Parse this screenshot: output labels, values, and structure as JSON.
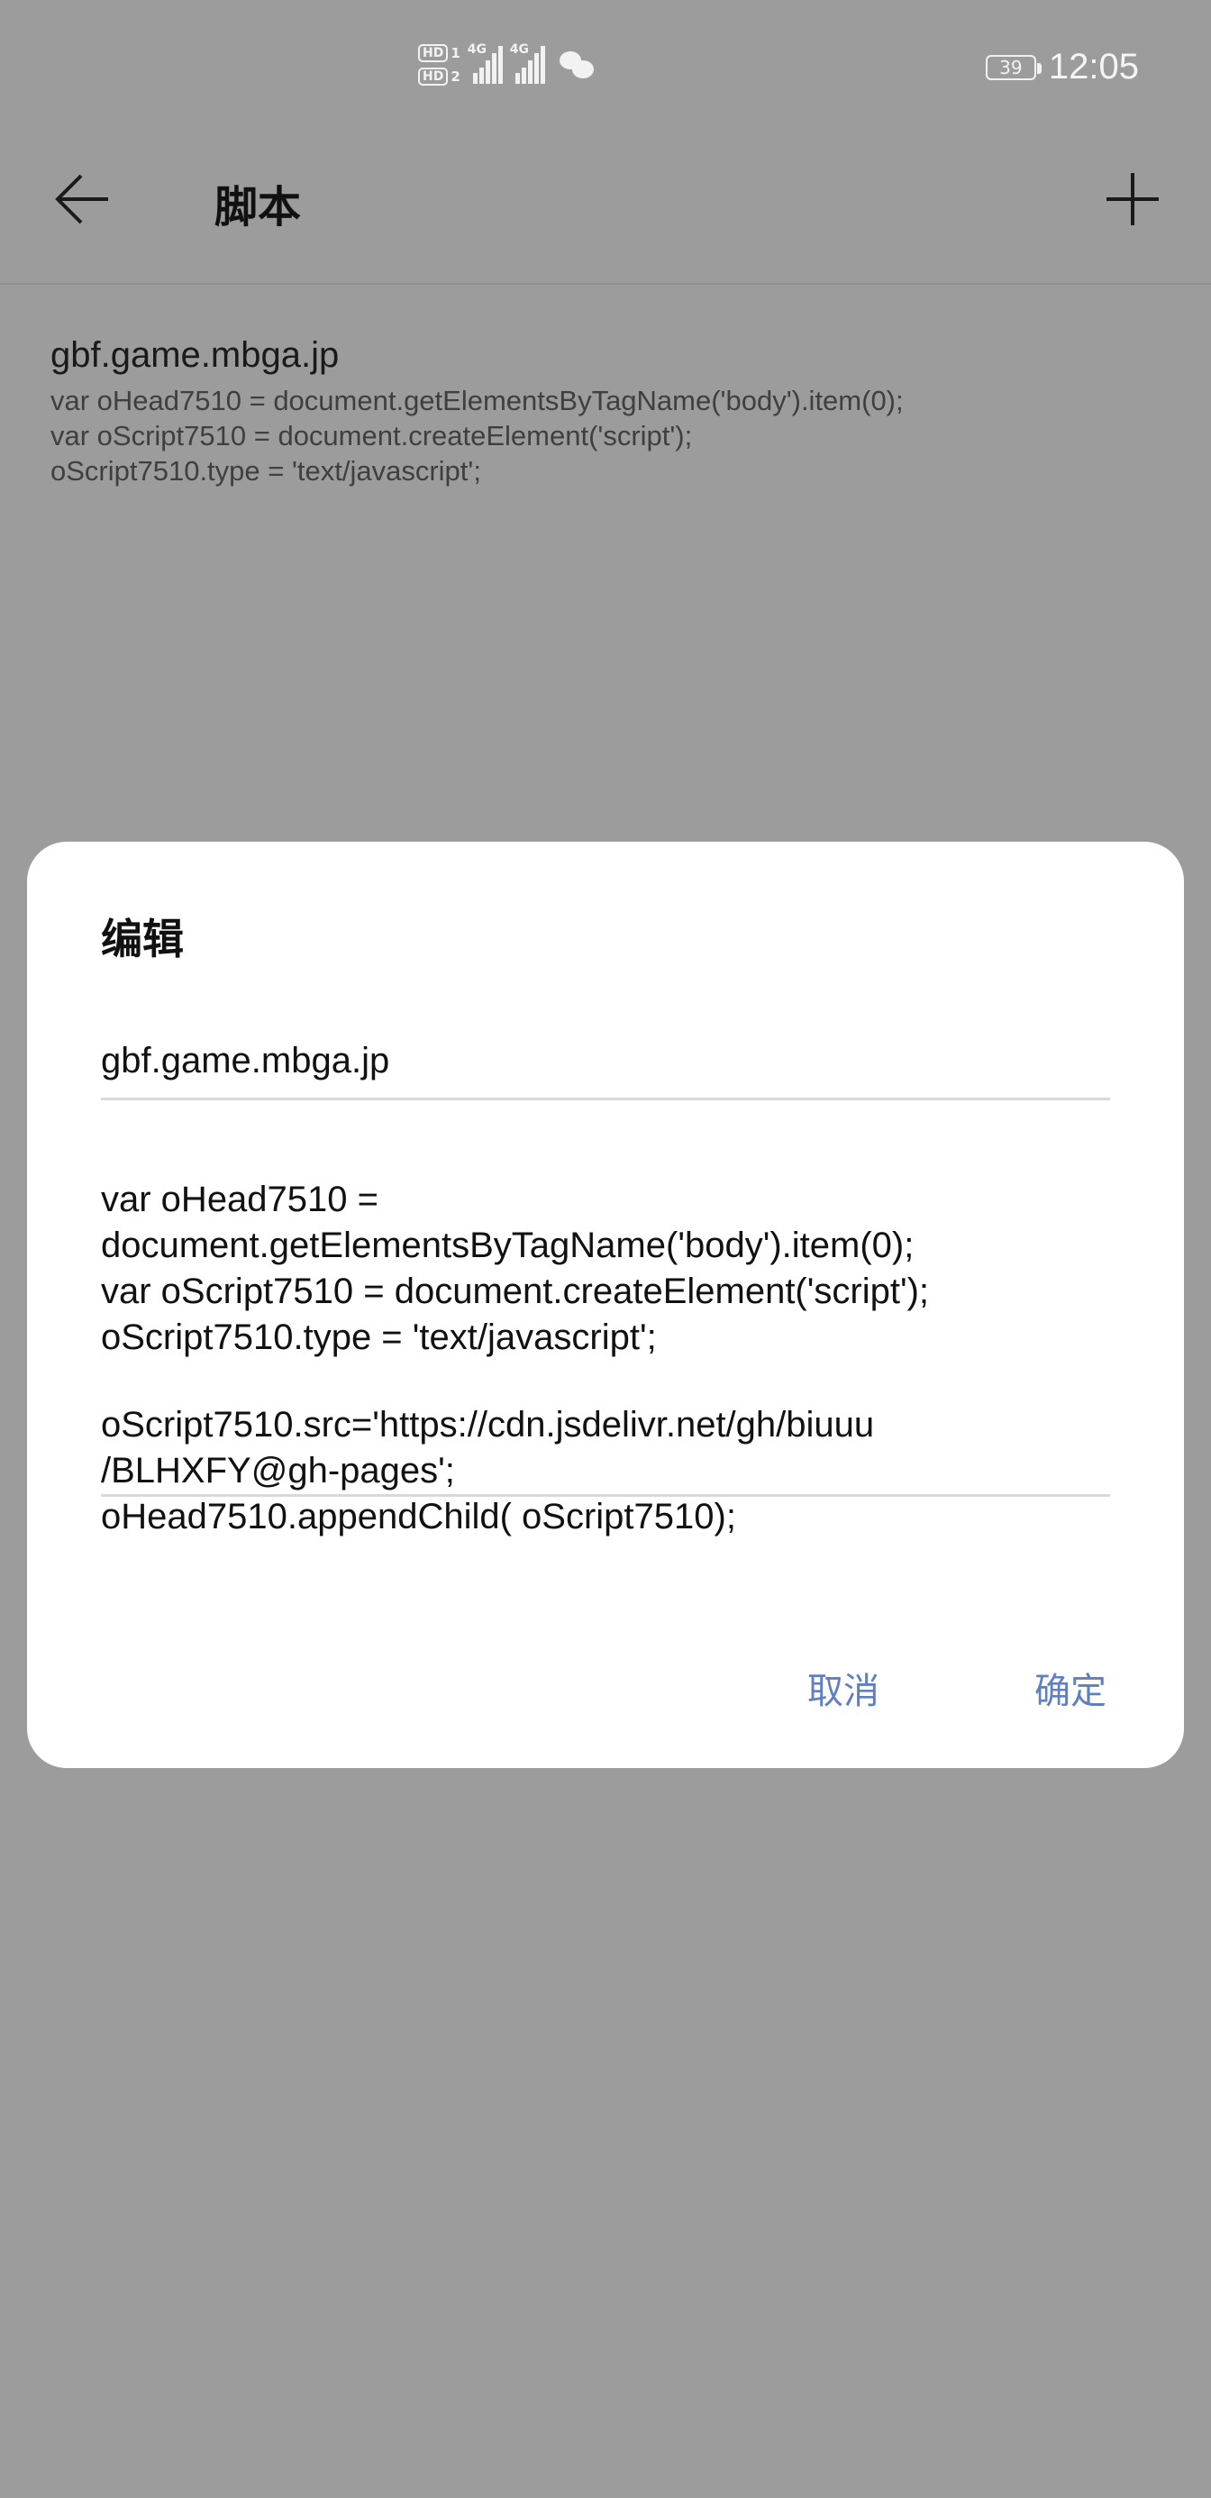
{
  "status_bar": {
    "hd1": "HD",
    "hd1_slot": "1",
    "hd2": "HD",
    "hd2_slot": "2",
    "net1": "4G",
    "net2": "4G",
    "battery": "39",
    "time": "12:05"
  },
  "app_bar": {
    "title": "脚本"
  },
  "list": {
    "items": [
      {
        "title": "gbf.game.mbga.jp",
        "lines": [
          "var oHead7510 = document.getElementsByTagName('body').item(0);",
          "var oScript7510 = document.createElement('script');",
          "oScript7510.type = 'text/javascript';"
        ]
      }
    ]
  },
  "dialog": {
    "title": "编辑",
    "name_value": "gbf.game.mbga.jp",
    "code_lines": [
      "var oHead7510 =",
      "document.getElementsByTagName('body').item(0);",
      "var oScript7510 = document.createElement('script');",
      "oScript7510.type = 'text/javascript';",
      "oScript7510.src='https://cdn.jsdelivr.net/gh/biuuu",
      "/BLHXFY@gh-pages';",
      "oHead7510.appendChild( oScript7510);"
    ],
    "cancel_label": "取消",
    "ok_label": "确定"
  },
  "colors": {
    "scrim": "#9c9c9c",
    "accent": "#5f7fbf"
  }
}
